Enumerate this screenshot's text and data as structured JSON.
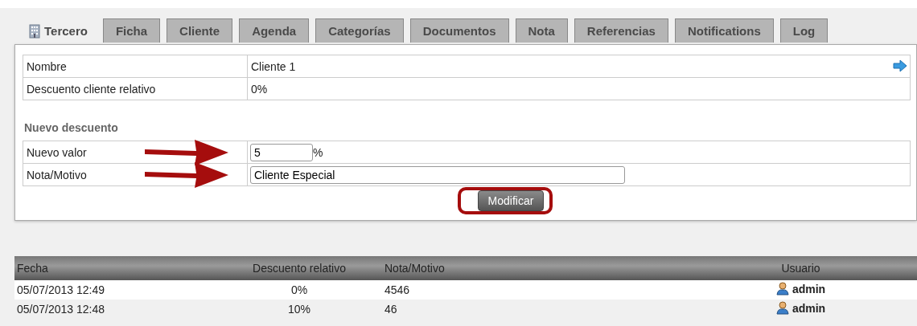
{
  "tabs": [
    {
      "label": "Tercero",
      "selected": true
    },
    {
      "label": "Ficha",
      "selected": false
    },
    {
      "label": "Cliente",
      "selected": false
    },
    {
      "label": "Agenda",
      "selected": false
    },
    {
      "label": "Categorías",
      "selected": false
    },
    {
      "label": "Documentos",
      "selected": false
    },
    {
      "label": "Nota",
      "selected": false
    },
    {
      "label": "Referencias",
      "selected": false
    },
    {
      "label": "Notifications",
      "selected": false
    },
    {
      "label": "Log",
      "selected": false
    }
  ],
  "info": [
    {
      "label": "Nombre",
      "value": "Cliente 1"
    },
    {
      "label": "Descuento cliente relativo",
      "value": "0%"
    }
  ],
  "form": {
    "title": "Nuevo descuento",
    "fields": [
      {
        "label": "Nuevo valor",
        "value": "5",
        "unit": "%",
        "kind": "short"
      },
      {
        "label": "Nota/Motivo",
        "value": "Cliente Especial",
        "kind": "long"
      }
    ],
    "button": "Modificar"
  },
  "history": {
    "columns": [
      "Fecha",
      "Descuento relativo",
      "Nota/Motivo",
      "Usuario"
    ],
    "rows": [
      {
        "date": "05/07/2013 12:49",
        "discount": "0%",
        "note": "4546",
        "user": "admin"
      },
      {
        "date": "05/07/2013 12:48",
        "discount": "10%",
        "note": "46",
        "user": "admin"
      }
    ]
  }
}
